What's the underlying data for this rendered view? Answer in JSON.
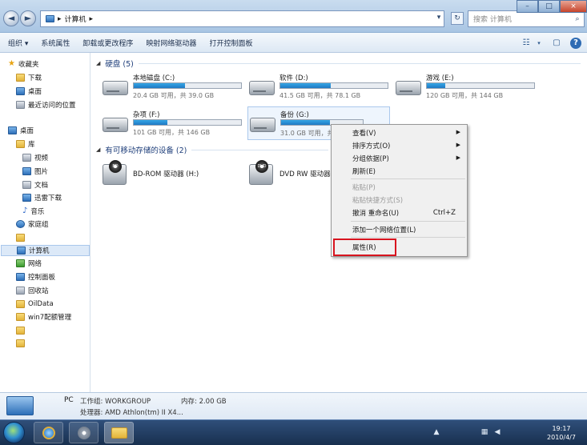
{
  "addressbar": {
    "back": "◄",
    "forward": "►",
    "separator": "▸",
    "location": "计算机",
    "chevron": "▸",
    "dropdown": "▾",
    "refresh": "↻",
    "search_placeholder": "搜索 计算机",
    "search_icon": "⌕"
  },
  "window_controls": {
    "minimize": "–",
    "maximize": "□",
    "close": "×"
  },
  "toolbar": {
    "organize": "组织 ▾",
    "system_properties": "系统属性",
    "uninstall": "卸载或更改程序",
    "map_drive": "映射网络驱动器",
    "control_panel": "打开控制面板",
    "views": "☷",
    "views_arrow": "▾",
    "preview": "▢",
    "help": "?"
  },
  "sidebar": {
    "items": [
      {
        "label": "收藏夹",
        "icon": "star-icon"
      },
      {
        "label": "下载",
        "icon": "folder-icon"
      },
      {
        "label": "桌面",
        "icon": "desktop-icon"
      },
      {
        "label": "最近访问的位置",
        "icon": "recent-icon"
      },
      {
        "label": "桌面",
        "icon": "desktop-icon"
      },
      {
        "label": "库",
        "icon": "library-icon"
      },
      {
        "label": "视频",
        "icon": "video-icon"
      },
      {
        "label": "图片",
        "icon": "pictures-icon"
      },
      {
        "label": "文档",
        "icon": "documents-icon"
      },
      {
        "label": "迅雷下载",
        "icon": "thunder-icon"
      },
      {
        "label": "音乐",
        "icon": "music-icon"
      },
      {
        "label": "家庭组",
        "icon": "homegroup-icon"
      },
      {
        "label": "",
        "icon": "user-folder-icon"
      },
      {
        "label": "计算机",
        "icon": "computer-icon"
      },
      {
        "label": "网络",
        "icon": "network-icon"
      },
      {
        "label": "控制面板",
        "icon": "control-panel-icon"
      },
      {
        "label": "回收站",
        "icon": "recycle-bin-icon"
      },
      {
        "label": "OilData",
        "icon": "folder-icon"
      },
      {
        "label": "win7配额管理",
        "icon": "folder-icon"
      },
      {
        "label": "",
        "icon": "folder-icon"
      },
      {
        "label": "",
        "icon": "folder-icon"
      }
    ]
  },
  "sections": {
    "hard_disks": "硬盘 (5)",
    "removable": "有可移动存储的设备 (2)",
    "toggle": "◢"
  },
  "drives": [
    {
      "name": "本地磁盘 (C:)",
      "info": "20.4 GB 可用，共 39.0 GB",
      "used_fraction": 0.48
    },
    {
      "name": "软件 (D:)",
      "info": "41.5 GB 可用，共 78.1 GB",
      "used_fraction": 0.47
    },
    {
      "name": "游戏 (E:)",
      "info": "120 GB 可用，共 144 GB",
      "used_fraction": 0.17
    },
    {
      "name": "杂项 (F:)",
      "info": "101 GB 可用，共 146 GB",
      "used_fraction": 0.31
    },
    {
      "name": "备份 (G:)",
      "info": "31.0 GB 可用，共",
      "used_fraction": 0.6
    }
  ],
  "removable_drives": [
    {
      "name": "BD-ROM 驱动器 (H:)",
      "disc_label": "BD"
    },
    {
      "name": "DVD RW 驱动器",
      "disc_label": "DVD"
    }
  ],
  "context_menu": {
    "view": "查看(V)",
    "sort": "排序方式(O)",
    "group": "分组依据(P)",
    "refresh": "刷新(E)",
    "paste": "粘贴(P)",
    "paste_shortcut": "粘贴快捷方式(S)",
    "undo_rename": "撤消 重命名(U)",
    "undo_shortcut": "Ctrl+Z",
    "add_network": "添加一个网络位置(L)",
    "properties": "属性(R)",
    "submenu_arrow": "▶"
  },
  "details": {
    "pc": "PC",
    "workgroup": "工作组: WORKGROUP",
    "memory": "内存: 2.00 GB",
    "processor": "处理器: AMD Athlon(tm) II X4..."
  },
  "taskbar": {
    "time": "19:17",
    "date": "2010/4/7",
    "tray_up": "▲",
    "tray_network": "▦",
    "tray_volume": "◀"
  }
}
